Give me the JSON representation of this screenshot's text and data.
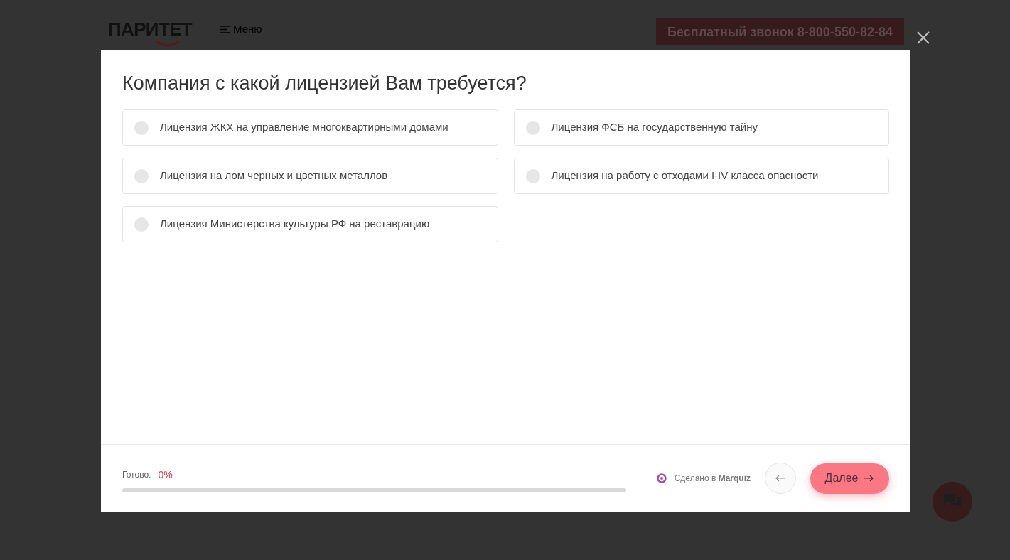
{
  "header": {
    "logo": "ПАРИТЕТ",
    "menu": "Меню",
    "phone_button": "Бесплатный звонок 8-800-550-82-84"
  },
  "quiz": {
    "question": "Компания с какой лицензией Вам требуется?",
    "options": [
      {
        "label": "Лицензия ЖКХ на управление многоквартирными домами",
        "selected": false
      },
      {
        "label": "Лицензия ФСБ на государственную тайну",
        "selected": false
      },
      {
        "label": "Лицензия на лом черных и цветных металлов",
        "selected": false
      },
      {
        "label": "Лицензия на работу с отходами I-IV класса опасности",
        "selected": false
      },
      {
        "label": "Лицензия Министерства культуры РФ на реставрацию",
        "selected": false
      }
    ],
    "progress": {
      "label": "Готово:",
      "value": "0%",
      "level": 0
    },
    "credit": "Сделано в **Marquiz**",
    "next_button": "Далее"
  }
}
